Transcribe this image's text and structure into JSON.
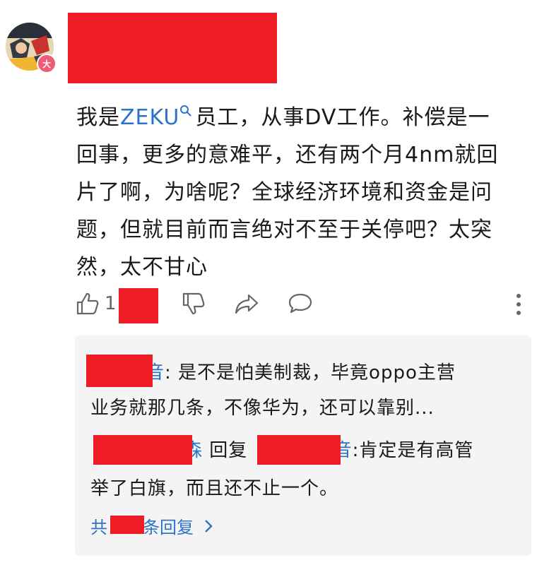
{
  "user": {
    "badge": "大"
  },
  "comment": {
    "before": "我是",
    "brand": "ZEKU",
    "line1_after": "员工，从事DV工作。补偿是一",
    "line2": "回事，更多的意难平，还有两个月4nm就回",
    "line3": "片了啊，为啥呢？全球经济环境和资金是问",
    "line4": "题，但就目前而言绝对不至于关停吧？太突",
    "line5": "然，太不甘心"
  },
  "actions": {
    "like_count_prefix": "1"
  },
  "replies": {
    "reply1_tail": "音",
    "reply1_line1": ": 是不是怕美制裁，毕竟oppo主营",
    "reply1_line2": "业务就那几条，不像华为，还可以靠别...",
    "reply2_name_tail": "森",
    "reply2_reply_word": "回复",
    "reply2_target_tail": "音",
    "reply2_line1": ":肯定是有高管",
    "reply2_line2": "举了白旗，而且还不止一个。",
    "more_prefix": "共",
    "more_suffix": "条回复"
  },
  "colors": {
    "link": "#2b73c8",
    "redaction": "#ee1c25",
    "reply_bg": "#f4f4f4"
  }
}
